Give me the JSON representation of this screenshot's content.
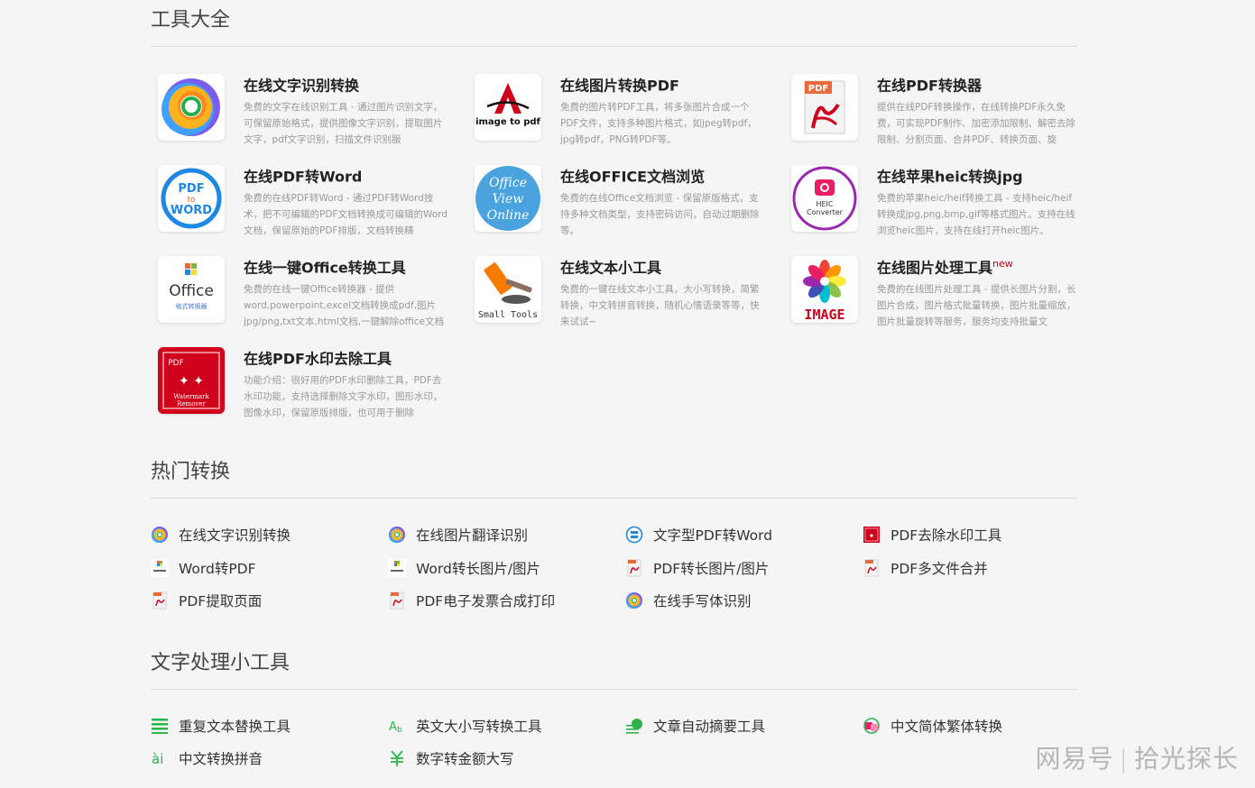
{
  "sections": {
    "tools": {
      "title": "工具大全"
    },
    "hot": {
      "title": "热门转换"
    },
    "text_tools": {
      "title": "文字处理小工具"
    }
  },
  "tools": [
    {
      "title": "在线文字识别转换",
      "new": "",
      "desc": "免费的文字在线识别工具 - 通过图片识别文字，可保留原始格式，提供图像文字识别，提取图片文字，pdf文字识别，扫描文件识别服",
      "icon": "ocr-ring-icon"
    },
    {
      "title": "在线图片转换PDF",
      "new": "",
      "desc": "免费的图片转PDF工具，将多张图片合成一个PDF文件，支持多种图片格式，如jpeg转pdf，jpg转pdf，PNG转PDF等。",
      "icon": "image-to-pdf-icon",
      "icon_text": "image to pdf"
    },
    {
      "title": "在线PDF转换器",
      "new": "",
      "desc": "提供在线PDF转换操作，在线转换PDF永久免费，可实现PDF制作、加密添加限制、解密去除限制、分割页面、合并PDF、转换页面、旋",
      "icon": "pdf-converter-icon",
      "icon_text": "PDF"
    },
    {
      "title": "在线PDF转Word",
      "new": "",
      "desc": "免费的在线PDF转Word - 通过PDF转Word技术，把不可编辑的PDF文档转换成可编辑的Word文档，保留原始的PDF排版，文档转换精",
      "icon": "pdf-to-word-icon",
      "icon_lines": [
        "PDF",
        "to",
        "WORD"
      ]
    },
    {
      "title": "在线OFFICE文档浏览",
      "new": "",
      "desc": "免费的在线Office文档浏览 - 保留原版格式，支持多种文档类型，支持密码访问，自动过期删除等。",
      "icon": "office-view-online-icon",
      "icon_lines": [
        "Office",
        "View",
        "Online"
      ]
    },
    {
      "title": "在线苹果heic转换jpg",
      "new": "",
      "desc": "免费的苹果heic/heif转换工具 - 支持heic/heif转换成jpg,png,bmp,gif等格式图片。支持在线浏览heic图片，支持在线打开heic图片。",
      "icon": "heic-converter-icon",
      "icon_lines": [
        "HEIC",
        "Converter"
      ]
    },
    {
      "title": "在线一键Office转换工具",
      "new": "",
      "desc": "免费的在线一键Office转换器 - 提供word,powerpoint,excel文档转换成pdf,图片jpg/png,txt文本,html文档,一键解除office文档限",
      "icon": "office-converter-icon",
      "icon_lines": [
        "Office",
        "格式转换器"
      ]
    },
    {
      "title": "在线文本小工具",
      "new": "",
      "desc": "免费的一键在线文本小工具，大小写转换，简繁转换，中文转拼音转换，随机心情语录等等，快来试试~",
      "icon": "small-tools-icon",
      "icon_text": "Small Tools"
    },
    {
      "title": "在线图片处理工具",
      "new": "new",
      "desc": "免费的在线图片处理工具 - 提供长图片分割，长图片合成，图片格式批量转换，图片批量缩放，图片批量旋转等服务，服务均支持批量文",
      "icon": "image-flower-icon",
      "icon_text": "IMAGE"
    },
    {
      "title": "在线PDF水印去除工具",
      "new": "",
      "desc": "功能介绍：很好用的PDF水印删除工具，PDF去水印功能，支持选择删除文字水印，图形水印，图像水印，保留原版排版，也可用于删除",
      "icon": "watermark-remover-icon",
      "icon_lines": [
        "PDF",
        "Watermark",
        "Remover"
      ]
    }
  ],
  "hot_links": [
    {
      "label": "在线文字识别转换",
      "icon": "ocr-ring-icon"
    },
    {
      "label": "在线图片翻译识别",
      "icon": "ocr-ring-icon"
    },
    {
      "label": "文字型PDF转Word",
      "icon": "pdf-to-word-icon"
    },
    {
      "label": "PDF去除水印工具",
      "icon": "watermark-remover-icon"
    },
    {
      "label": "Word转PDF",
      "icon": "office-converter-icon"
    },
    {
      "label": "Word转长图片/图片",
      "icon": "office-converter-icon"
    },
    {
      "label": "PDF转长图片/图片",
      "icon": "pdf-converter-icon"
    },
    {
      "label": "PDF多文件合并",
      "icon": "pdf-converter-icon"
    },
    {
      "label": "PDF提取页面",
      "icon": "pdf-converter-icon"
    },
    {
      "label": "PDF电子发票合成打印",
      "icon": "pdf-converter-icon"
    },
    {
      "label": "在线手写体识别",
      "icon": "ocr-ring-icon"
    }
  ],
  "text_links": [
    {
      "label": "重复文本替换工具",
      "icon": "list-replace-icon"
    },
    {
      "label": "英文大小写转换工具",
      "icon": "case-convert-icon"
    },
    {
      "label": "文章自动摘要工具",
      "icon": "summary-icon"
    },
    {
      "label": "中文简体繁体转换",
      "icon": "simplified-traditional-icon"
    },
    {
      "label": "中文转换拼音",
      "icon": "pinyin-icon"
    },
    {
      "label": "数字转金额大写",
      "icon": "currency-icon"
    }
  ],
  "watermark": {
    "left": "网易号",
    "right": "拾光探长"
  },
  "colors": {
    "ocr_orange": "#f5a623",
    "ocr_purple": "#8b5cf6",
    "ocr_blue": "#3b82f6",
    "pdf_red": "#d0021b",
    "pdf_word_blue": "#1e88e5",
    "office_view_blue": "#4aa3df",
    "heic_pink": "#e91e63",
    "text_green": "#2db34a"
  }
}
